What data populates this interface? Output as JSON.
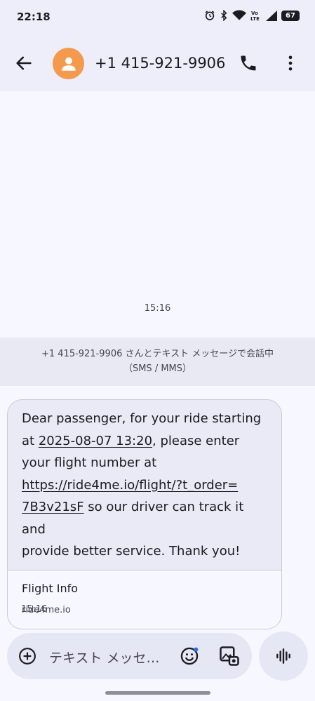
{
  "status_bar": {
    "time": "22:18",
    "battery": "67",
    "icons": [
      "alarm-icon",
      "bluetooth-icon",
      "wifi-icon",
      "volte-icon",
      "signal-icon",
      "battery-icon"
    ]
  },
  "header": {
    "contact": "+1 415-921-9906",
    "icons": [
      "back-arrow-icon",
      "person-icon",
      "phone-icon",
      "more-vert-icon"
    ]
  },
  "conversation": {
    "timestamp": "15:16",
    "banner_line1": "+1 415-921-9906 さんとテキスト メッセージで会話中",
    "banner_line2": "（SMS / MMS）",
    "message": {
      "line1": "Dear passenger, for your ride starting",
      "line2_prefix": "at ",
      "line2_date": "2025-08-07 13:20",
      "line2_suffix": ", please enter",
      "line3": "your flight number at",
      "link_line1": "https://ride4me.io/flight/?t_order=",
      "link_line2": "7B3v21sF",
      "line5_suffix": " so our driver can track it and",
      "line6": "provide better service. Thank you!",
      "preview_title": "Flight Info",
      "preview_domain": "ride4me.io",
      "time": "15:16"
    }
  },
  "compose": {
    "placeholder": "テキスト メッセ…",
    "icons": [
      "add-circle-icon",
      "emoji-icon",
      "gallery-icon",
      "voice-waveform-icon"
    ]
  },
  "colors": {
    "accent_avatar": "#f39a4c",
    "app_bar": "#eeeefb",
    "background": "#f7f7ff"
  }
}
